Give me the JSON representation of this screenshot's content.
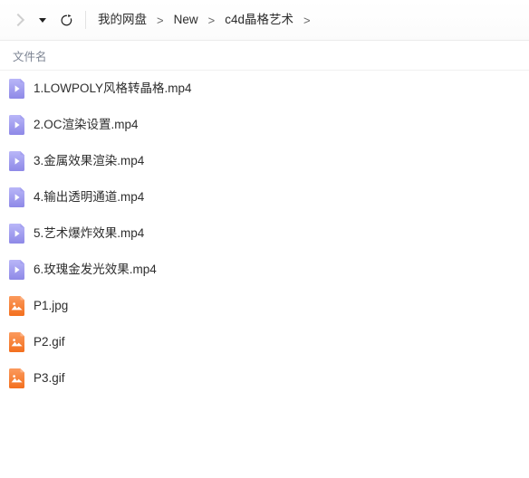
{
  "toolbar": {
    "collapse_icon": "chevron-right-icon",
    "dropdown_icon": "caret-down-icon",
    "refresh_icon": "refresh-icon",
    "breadcrumb": {
      "separator": ">",
      "items": [
        {
          "label": "我的网盘"
        },
        {
          "label": "New"
        },
        {
          "label": "c4d晶格艺术"
        }
      ],
      "trailing_separator": ">"
    }
  },
  "list": {
    "columns": [
      {
        "key": "filename",
        "label": "文件名"
      }
    ],
    "icon_colors": {
      "video_top": "#b7b4f7",
      "video_bottom": "#8f8ae8",
      "image_top": "#fb9455",
      "image_bottom": "#f4701f",
      "glyph": "#ffffff"
    },
    "rows": [
      {
        "name": "1.LOWPOLY风格转晶格.mp4",
        "icon": "video-file-icon",
        "type": "mp4"
      },
      {
        "name": "2.OC渲染设置.mp4",
        "icon": "video-file-icon",
        "type": "mp4"
      },
      {
        "name": "3.金属效果渲染.mp4",
        "icon": "video-file-icon",
        "type": "mp4"
      },
      {
        "name": "4.输出透明通道.mp4",
        "icon": "video-file-icon",
        "type": "mp4"
      },
      {
        "name": "5.艺术爆炸效果.mp4",
        "icon": "video-file-icon",
        "type": "mp4"
      },
      {
        "name": "6.玫瑰金发光效果.mp4",
        "icon": "video-file-icon",
        "type": "mp4"
      },
      {
        "name": "P1.jpg",
        "icon": "image-file-icon",
        "type": "jpg"
      },
      {
        "name": "P2.gif",
        "icon": "image-file-icon",
        "type": "gif"
      },
      {
        "name": "P3.gif",
        "icon": "image-file-icon",
        "type": "gif"
      }
    ]
  }
}
